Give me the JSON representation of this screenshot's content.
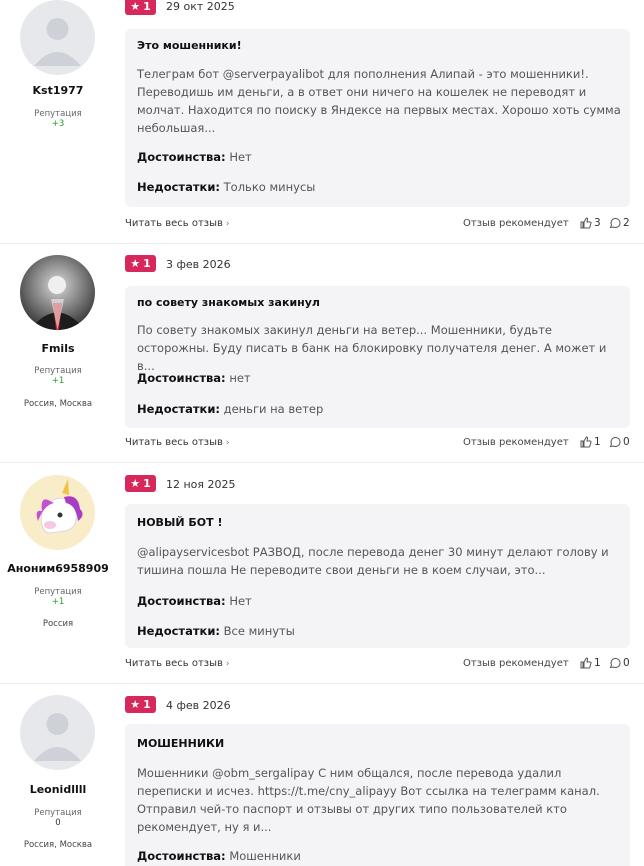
{
  "common": {
    "reputation_label": "Репутация",
    "read_more": "Читать весь отзыв",
    "recommend": "Отзыв рекомендует",
    "pros_label": "Достоинства:",
    "cons_label": "Недостатки:"
  },
  "colors": {
    "badge": "#d6285a",
    "reputation_positive": "#2b9b2b",
    "card_bg": "#f4f4f6"
  },
  "reviews": [
    {
      "author": "Kst1977",
      "reputation": "+3",
      "location": "",
      "rating": "1",
      "date": "29 окт 2025",
      "title": "Это мошенники!",
      "text": "Телеграм бот @serverpayalibot для пополнения Алипай - это мошенники!. Переводишь им деньги, а в ответ они ничего на кошелек не переводят и молчат. Находится по поиску в Яндексе на первых местах. Хорошо хоть сумма небольшая...",
      "pros": "Нет",
      "cons": "Только минусы",
      "likes": "3",
      "comments": "2",
      "avatar_icon": "default-avatar-icon"
    },
    {
      "author": "Fmils",
      "reputation": "+1",
      "location": "Россия, Москва",
      "rating": "1",
      "date": "3 фев 2026",
      "title": "по совету знакомых закинул",
      "text": "По совету знакомых закинул деньги на ветер... Мошенники, будьте осторожны. Буду писать в банк на блокировку получателя денег. А может и в...",
      "pros": "нет",
      "cons": "деньги на ветер",
      "likes": "1",
      "comments": "0",
      "avatar_icon": "photo-avatar-icon"
    },
    {
      "author": "Аноним6958909",
      "reputation": "+1",
      "location": "Россия",
      "rating": "1",
      "date": "12 ноя 2025",
      "title": "НОВЫЙ БОТ !",
      "text": "@alipayservicesbot РАЗВОД, после перевода денег 30 минут делают голову и тишина пошла Не переводите свои деньги не в коем случаи, это...",
      "pros": "Нет",
      "cons": "Все минуты",
      "likes": "1",
      "comments": "0",
      "avatar_icon": "unicorn-avatar-icon"
    },
    {
      "author": "Leonidllll",
      "reputation": "0",
      "location": "Россия, Москва",
      "rating": "1",
      "date": "4 фев 2026",
      "title": "МОШЕННИКИ",
      "text": "Мошенники @obm_sergalipay С ним общался, после перевода удалил переписки и исчез. https://t.me/cny_alipayy Вот ссылка на телеграмм канал. Отправил чей-то паспорт и отзывы от других типо пользователей кто рекомендует, ну я и...",
      "pros": "Мошенники",
      "cons": "",
      "likes": "",
      "comments": "",
      "avatar_icon": "default-avatar-icon"
    }
  ]
}
